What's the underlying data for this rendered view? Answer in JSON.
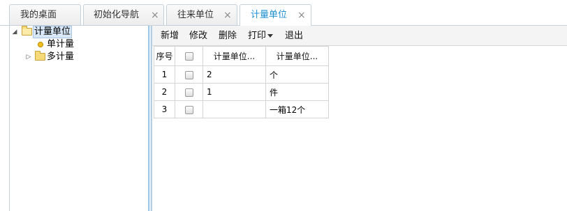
{
  "tabs": [
    {
      "label": "我的桌面",
      "closable": false,
      "active": false
    },
    {
      "label": "初始化导航",
      "closable": true,
      "active": false
    },
    {
      "label": "往来单位",
      "closable": true,
      "active": false
    },
    {
      "label": "计量单位",
      "closable": true,
      "active": true
    }
  ],
  "close_glyph": "×",
  "tree": {
    "root": {
      "label": "计量单位",
      "expanded": true,
      "selected": true
    },
    "children": [
      {
        "label": "单计量",
        "kind": "leaf"
      },
      {
        "label": "多计量",
        "kind": "folder",
        "expanded": false
      }
    ]
  },
  "toolbar": {
    "add": "新增",
    "edit": "修改",
    "delete": "删除",
    "print": "打印",
    "exit": "退出"
  },
  "grid": {
    "headers": [
      "序号",
      "",
      "计量单位...",
      "计量单位..."
    ],
    "rows": [
      {
        "index": "1",
        "col_a": "2",
        "col_b": "个"
      },
      {
        "index": "2",
        "col_a": "1",
        "col_b": "件"
      },
      {
        "index": "3",
        "col_a": "",
        "col_b": "一箱12个"
      }
    ]
  },
  "colors": {
    "active_tab_text": "#1f8fd0",
    "splitter": "#9fc6e6"
  }
}
